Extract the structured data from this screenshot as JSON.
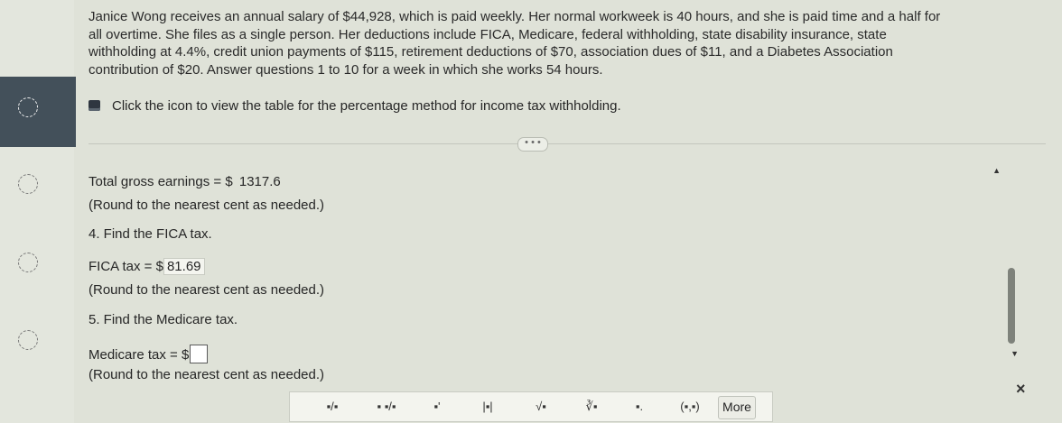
{
  "problem": {
    "intro_text": "Janice Wong receives an annual salary of $44,928, which is paid weekly. Her normal workweek is 40 hours, and she is paid time and a half for all overtime. She files as a single person. Her deductions include FICA, Medicare, federal withholding, state disability insurance, state withholding at 4.4%, credit union payments of $115, retirement deductions of $70, association dues of $11, and a Diabetes Association contribution of $20. Answer questions 1 to 10 for a week in which she works 54 hours.",
    "icon_text": "Click the icon to view the table for the percentage method for income tax withholding.",
    "expand_label": "• • •"
  },
  "gross": {
    "label": "Total gross earnings = $",
    "value": "1317.6",
    "hint": "(Round to the nearest cent as needed.)"
  },
  "q4": {
    "question": "4. Find the FICA tax.",
    "label": "FICA tax = $",
    "value": "81.69",
    "hint": "(Round to the nearest cent as needed.)"
  },
  "q5": {
    "question": "5. Find the Medicare tax.",
    "label": "Medicare tax = $",
    "value": "",
    "hint": "(Round to the nearest cent as needed.)"
  },
  "toolbar": {
    "buttons": [
      "▪/▪",
      "▪ ▪/▪",
      "▪'",
      "|▪|",
      "√▪",
      "∛▪",
      "▪.",
      "(▪,▪)"
    ],
    "more_label": "More"
  },
  "close_label": "×"
}
